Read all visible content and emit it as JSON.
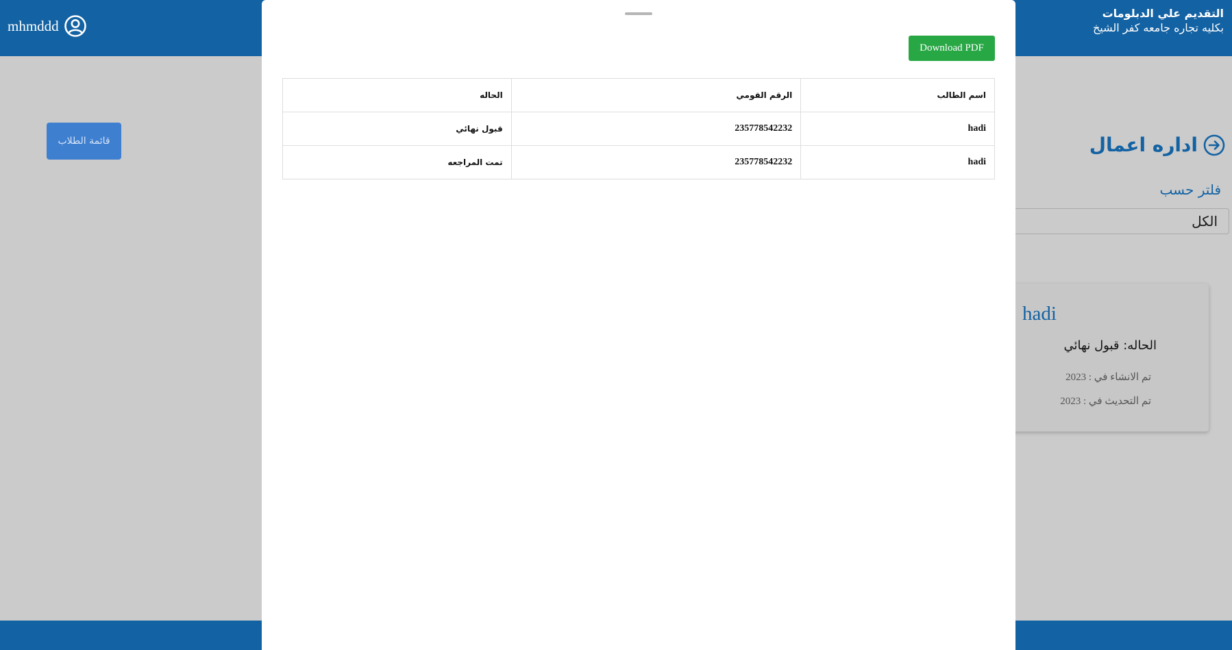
{
  "header": {
    "username": "mhmddd",
    "site_title": "التقديم علي الدبلومات",
    "site_subtitle": "بكليه تجاره جامعه كفر الشيخ",
    "brand_color": "#1362a3"
  },
  "sidebar": {
    "students_list_label": "قائمة الطلاب"
  },
  "main": {
    "section_title": "اداره اعمال",
    "filter_label": "فلتر حسب",
    "filter_value": "الكل",
    "card": {
      "name": "hadi",
      "status": "الحاله: قبول نهائي",
      "created": "تم الانشاء في : 2023",
      "updated": "تم التحديث في : 2023"
    }
  },
  "modal": {
    "download_label": "Download PDF",
    "table": {
      "headers": {
        "name": "اسم الطالب",
        "national_id": "الرقم القومي",
        "status": "الحاله"
      },
      "rows": [
        {
          "name": "hadi",
          "national_id": "235778542232",
          "status": "قبول نهائي"
        },
        {
          "name": "hadi",
          "national_id": "235778542232",
          "status": "تمت المراجعه"
        }
      ]
    }
  },
  "icons": {
    "user": "user-circle-icon",
    "section": "arrow-circle-right-icon"
  }
}
